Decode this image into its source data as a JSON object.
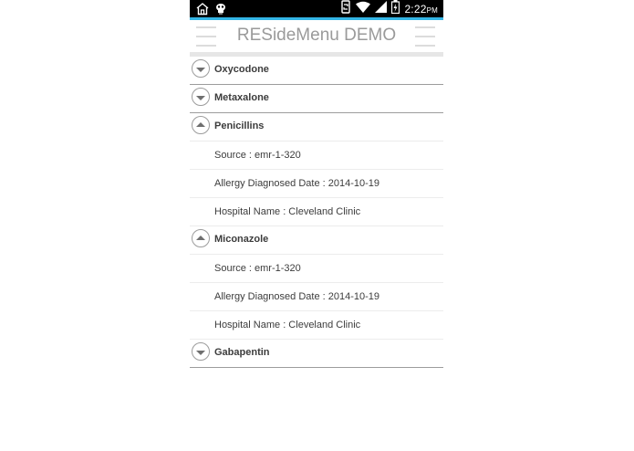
{
  "status_bar": {
    "time": "2:22",
    "ampm": "PM",
    "accent_color": "#33b5e5",
    "left_icons": [
      "home-icon",
      "bug-icon"
    ],
    "right_icons": [
      "sync-icon",
      "wifi-icon",
      "signal-icon",
      "battery-charging-icon"
    ]
  },
  "header": {
    "title": "RESideMenu DEMO",
    "left_menu_icon": "hamburger-icon",
    "right_menu_icon": "hamburger-icon"
  },
  "allergies": [
    {
      "name": "Oxycodone",
      "expanded": false,
      "details": []
    },
    {
      "name": "Metaxalone",
      "expanded": false,
      "details": []
    },
    {
      "name": "Penicillins",
      "expanded": true,
      "details": [
        "Source : emr-1-320",
        "Allergy Diagnosed Date : 2014-10-19",
        "Hospital Name : Cleveland Clinic"
      ]
    },
    {
      "name": "Miconazole",
      "expanded": true,
      "details": [
        "Source : emr-1-320",
        "Allergy Diagnosed Date : 2014-10-19",
        "Hospital Name : Cleveland Clinic"
      ]
    },
    {
      "name": "Gabapentin",
      "expanded": false,
      "details": []
    }
  ]
}
